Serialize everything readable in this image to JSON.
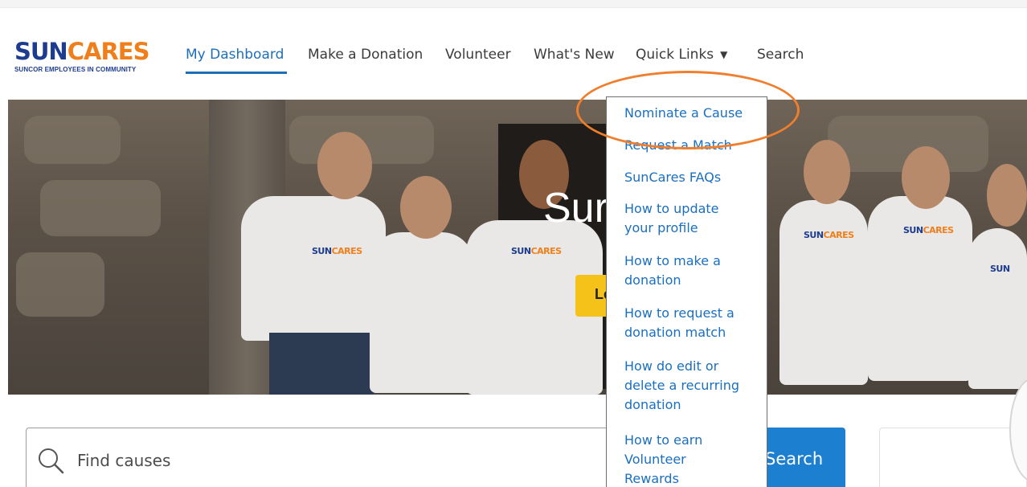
{
  "brand": {
    "logo_sun": "SUN",
    "logo_cares": "CARES",
    "tagline": "SUNCOR EMPLOYEES IN COMMUNITY",
    "colors": {
      "primary": "#1d3c8f",
      "accent": "#f07f1b",
      "link": "#1d6fb8",
      "button": "#1d7fd0",
      "hero_button": "#f5c21a",
      "annotation": "#ef7f2c"
    }
  },
  "nav": {
    "items": [
      {
        "label": "My Dashboard",
        "active": true
      },
      {
        "label": "Make a Donation"
      },
      {
        "label": "Volunteer"
      },
      {
        "label": "What's New"
      },
      {
        "label": "Quick Links",
        "caret": "▼"
      },
      {
        "label": "Search"
      }
    ]
  },
  "hero": {
    "title_visible": "Sur",
    "button_visible": "Le",
    "shirt_logo_sun": "SUN",
    "shirt_logo_cares": "CARES"
  },
  "quick_links": {
    "items": [
      {
        "lines": [
          "Nominate a Cause"
        ]
      },
      {
        "lines": [
          "Request a Match"
        ]
      },
      {
        "lines": [
          "SunCares FAQs"
        ]
      },
      {
        "lines": [
          "How to update",
          "your profile"
        ]
      },
      {
        "lines": [
          "How to make a",
          "donation"
        ]
      },
      {
        "lines": [
          "How to request a",
          "donation match"
        ]
      },
      {
        "lines": [
          "How do edit or",
          "delete a recurring",
          "donation"
        ]
      },
      {
        "lines": [
          "How to earn",
          "Volunteer",
          "Rewards"
        ]
      }
    ]
  },
  "search": {
    "placeholder": "Find causes",
    "icon": "search-icon",
    "button_visible": "Search"
  }
}
